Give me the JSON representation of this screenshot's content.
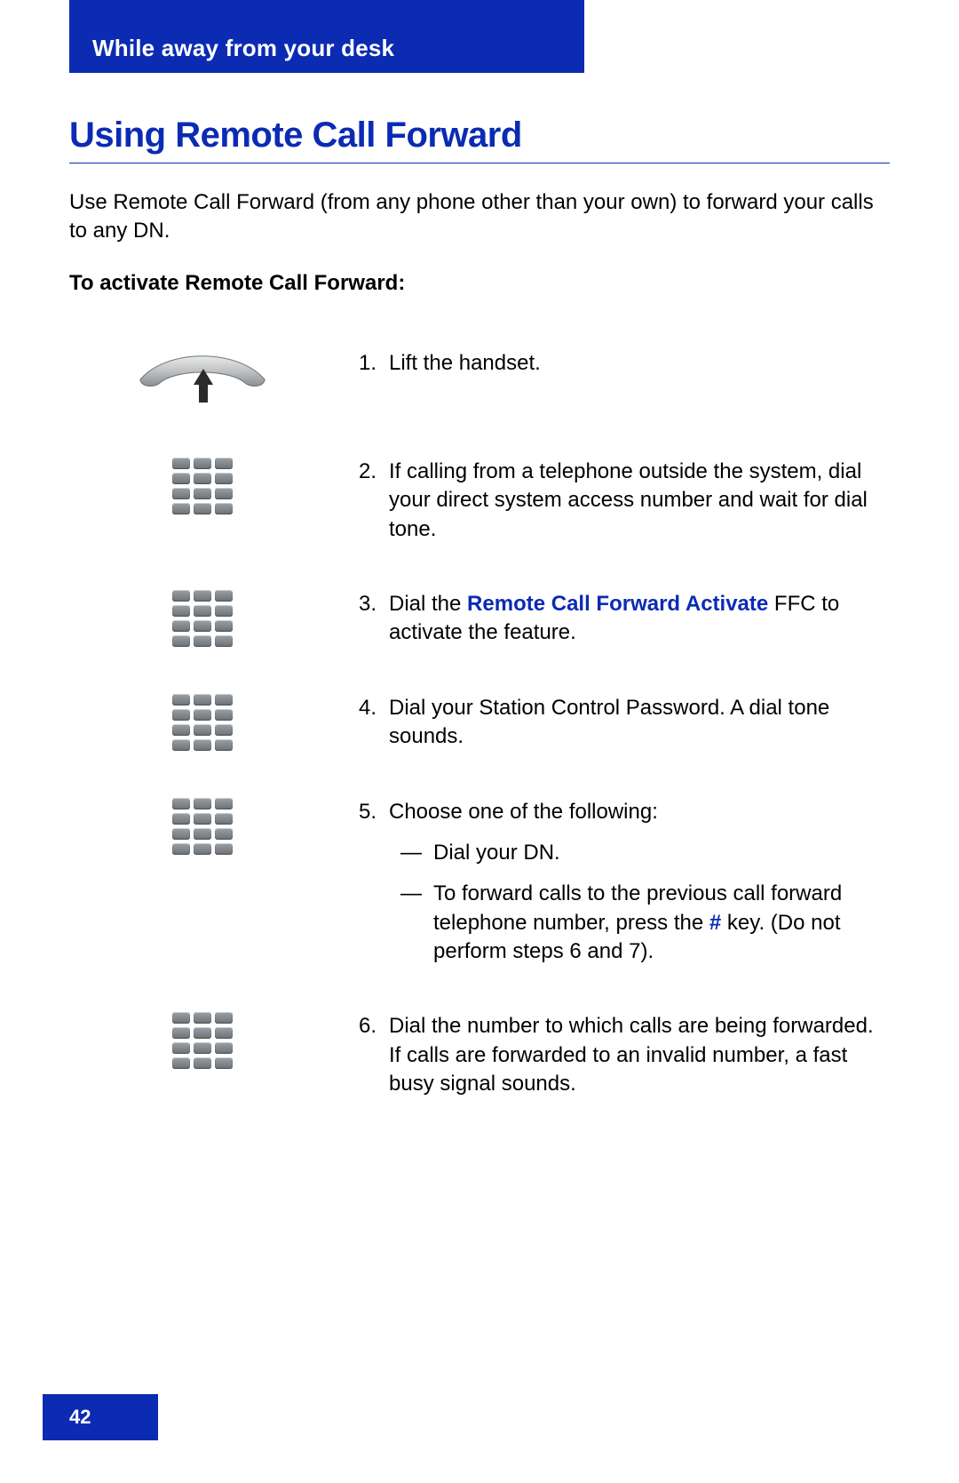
{
  "colors": {
    "brand_blue": "#0b2bb3"
  },
  "header": {
    "section": "While away from your desk"
  },
  "page": {
    "number": "42"
  },
  "title": "Using Remote Call Forward",
  "intro": "Use Remote Call Forward (from any phone other than your own) to forward your calls to any DN.",
  "subhead": "To activate Remote Call Forward:",
  "steps": [
    {
      "n": "1.",
      "icon": "handset",
      "text": "Lift the handset."
    },
    {
      "n": "2.",
      "icon": "keypad",
      "text": "If calling from a telephone outside the system, dial your direct system access number and wait for dial tone."
    },
    {
      "n": "3.",
      "icon": "keypad",
      "prefix": "Dial the ",
      "highlight": "Remote Call Forward Activate",
      "suffix": " FFC to activate the feature."
    },
    {
      "n": "4.",
      "icon": "keypad",
      "text": "Dial your Station Control Password. A dial tone sounds."
    },
    {
      "n": "5.",
      "icon": "keypad",
      "text": "Choose one of the following:",
      "sub": [
        {
          "text": "Dial your DN."
        },
        {
          "pre": "To forward calls to the previous call forward telephone number, press the ",
          "hl": "#",
          "post": " key. (Do not perform steps 6 and 7)."
        }
      ]
    },
    {
      "n": "6.",
      "icon": "keypad",
      "text": "Dial the number to which calls are being forwarded. If calls are forwarded to an invalid number, a fast busy signal sounds."
    }
  ]
}
